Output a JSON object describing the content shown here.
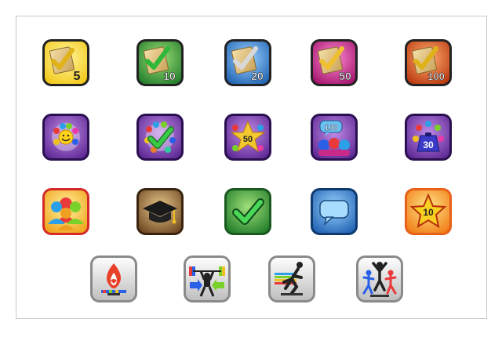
{
  "badges": {
    "row1": [
      {
        "name": "checklist-5-icon",
        "count": "5",
        "color": "#f2d71a"
      },
      {
        "name": "checklist-10-icon",
        "count": "10",
        "color": "#2f9a35"
      },
      {
        "name": "checklist-20-icon",
        "count": "20",
        "color": "#2a73c8"
      },
      {
        "name": "checklist-50-icon",
        "count": "50",
        "color": "#c0187a"
      },
      {
        "name": "checklist-100-icon",
        "count": "100",
        "color": "#d04513"
      }
    ],
    "row2": [
      {
        "name": "friends-group-icon",
        "count": "",
        "color": "#7a3fae"
      },
      {
        "name": "friends-check-icon",
        "count": "",
        "color": "#7a3fae"
      },
      {
        "name": "friends-50-icon",
        "count": "50",
        "color": "#7a3fae"
      },
      {
        "name": "friends-100-icon",
        "count": "100",
        "color": "#7a3fae"
      },
      {
        "name": "friends-30-icon",
        "count": "30",
        "color": "#7a3fae"
      }
    ],
    "row3": [
      {
        "name": "team-icon",
        "count": "",
        "color": "#e8a21a"
      },
      {
        "name": "graduation-cap-icon",
        "count": "",
        "color": "#5b3a1e"
      },
      {
        "name": "checkmark-icon",
        "count": "",
        "color": "#2f9a35"
      },
      {
        "name": "chat-bubble-icon",
        "count": "",
        "color": "#2a73c8"
      },
      {
        "name": "star-10-icon",
        "count": "10",
        "color": "#f39a12"
      }
    ],
    "row4": [
      {
        "name": "torch-flame-icon",
        "count": "",
        "color": "#e8412a"
      },
      {
        "name": "weightlifter-icon",
        "count": "",
        "color": "#222222"
      },
      {
        "name": "runner-icon",
        "count": "",
        "color": "#222222"
      },
      {
        "name": "team-cheer-icon",
        "count": "",
        "color": "#222222"
      }
    ]
  }
}
